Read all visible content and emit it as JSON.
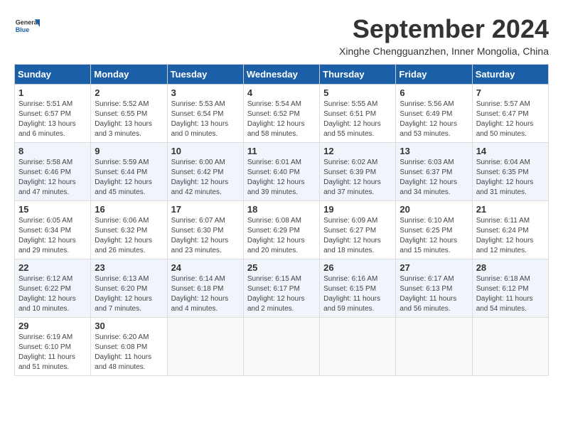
{
  "header": {
    "logo_general": "General",
    "logo_blue": "Blue",
    "month_title": "September 2024",
    "location": "Xinghe Chengguanzhen, Inner Mongolia, China"
  },
  "weekdays": [
    "Sunday",
    "Monday",
    "Tuesday",
    "Wednesday",
    "Thursday",
    "Friday",
    "Saturday"
  ],
  "weeks": [
    [
      {
        "day": "1",
        "info": "Sunrise: 5:51 AM\nSunset: 6:57 PM\nDaylight: 13 hours\nand 6 minutes."
      },
      {
        "day": "2",
        "info": "Sunrise: 5:52 AM\nSunset: 6:55 PM\nDaylight: 13 hours\nand 3 minutes."
      },
      {
        "day": "3",
        "info": "Sunrise: 5:53 AM\nSunset: 6:54 PM\nDaylight: 13 hours\nand 0 minutes."
      },
      {
        "day": "4",
        "info": "Sunrise: 5:54 AM\nSunset: 6:52 PM\nDaylight: 12 hours\nand 58 minutes."
      },
      {
        "day": "5",
        "info": "Sunrise: 5:55 AM\nSunset: 6:51 PM\nDaylight: 12 hours\nand 55 minutes."
      },
      {
        "day": "6",
        "info": "Sunrise: 5:56 AM\nSunset: 6:49 PM\nDaylight: 12 hours\nand 53 minutes."
      },
      {
        "day": "7",
        "info": "Sunrise: 5:57 AM\nSunset: 6:47 PM\nDaylight: 12 hours\nand 50 minutes."
      }
    ],
    [
      {
        "day": "8",
        "info": "Sunrise: 5:58 AM\nSunset: 6:46 PM\nDaylight: 12 hours\nand 47 minutes."
      },
      {
        "day": "9",
        "info": "Sunrise: 5:59 AM\nSunset: 6:44 PM\nDaylight: 12 hours\nand 45 minutes."
      },
      {
        "day": "10",
        "info": "Sunrise: 6:00 AM\nSunset: 6:42 PM\nDaylight: 12 hours\nand 42 minutes."
      },
      {
        "day": "11",
        "info": "Sunrise: 6:01 AM\nSunset: 6:40 PM\nDaylight: 12 hours\nand 39 minutes."
      },
      {
        "day": "12",
        "info": "Sunrise: 6:02 AM\nSunset: 6:39 PM\nDaylight: 12 hours\nand 37 minutes."
      },
      {
        "day": "13",
        "info": "Sunrise: 6:03 AM\nSunset: 6:37 PM\nDaylight: 12 hours\nand 34 minutes."
      },
      {
        "day": "14",
        "info": "Sunrise: 6:04 AM\nSunset: 6:35 PM\nDaylight: 12 hours\nand 31 minutes."
      }
    ],
    [
      {
        "day": "15",
        "info": "Sunrise: 6:05 AM\nSunset: 6:34 PM\nDaylight: 12 hours\nand 29 minutes."
      },
      {
        "day": "16",
        "info": "Sunrise: 6:06 AM\nSunset: 6:32 PM\nDaylight: 12 hours\nand 26 minutes."
      },
      {
        "day": "17",
        "info": "Sunrise: 6:07 AM\nSunset: 6:30 PM\nDaylight: 12 hours\nand 23 minutes."
      },
      {
        "day": "18",
        "info": "Sunrise: 6:08 AM\nSunset: 6:29 PM\nDaylight: 12 hours\nand 20 minutes."
      },
      {
        "day": "19",
        "info": "Sunrise: 6:09 AM\nSunset: 6:27 PM\nDaylight: 12 hours\nand 18 minutes."
      },
      {
        "day": "20",
        "info": "Sunrise: 6:10 AM\nSunset: 6:25 PM\nDaylight: 12 hours\nand 15 minutes."
      },
      {
        "day": "21",
        "info": "Sunrise: 6:11 AM\nSunset: 6:24 PM\nDaylight: 12 hours\nand 12 minutes."
      }
    ],
    [
      {
        "day": "22",
        "info": "Sunrise: 6:12 AM\nSunset: 6:22 PM\nDaylight: 12 hours\nand 10 minutes."
      },
      {
        "day": "23",
        "info": "Sunrise: 6:13 AM\nSunset: 6:20 PM\nDaylight: 12 hours\nand 7 minutes."
      },
      {
        "day": "24",
        "info": "Sunrise: 6:14 AM\nSunset: 6:18 PM\nDaylight: 12 hours\nand 4 minutes."
      },
      {
        "day": "25",
        "info": "Sunrise: 6:15 AM\nSunset: 6:17 PM\nDaylight: 12 hours\nand 2 minutes."
      },
      {
        "day": "26",
        "info": "Sunrise: 6:16 AM\nSunset: 6:15 PM\nDaylight: 11 hours\nand 59 minutes."
      },
      {
        "day": "27",
        "info": "Sunrise: 6:17 AM\nSunset: 6:13 PM\nDaylight: 11 hours\nand 56 minutes."
      },
      {
        "day": "28",
        "info": "Sunrise: 6:18 AM\nSunset: 6:12 PM\nDaylight: 11 hours\nand 54 minutes."
      }
    ],
    [
      {
        "day": "29",
        "info": "Sunrise: 6:19 AM\nSunset: 6:10 PM\nDaylight: 11 hours\nand 51 minutes."
      },
      {
        "day": "30",
        "info": "Sunrise: 6:20 AM\nSunset: 6:08 PM\nDaylight: 11 hours\nand 48 minutes."
      },
      {
        "day": "",
        "info": ""
      },
      {
        "day": "",
        "info": ""
      },
      {
        "day": "",
        "info": ""
      },
      {
        "day": "",
        "info": ""
      },
      {
        "day": "",
        "info": ""
      }
    ]
  ]
}
